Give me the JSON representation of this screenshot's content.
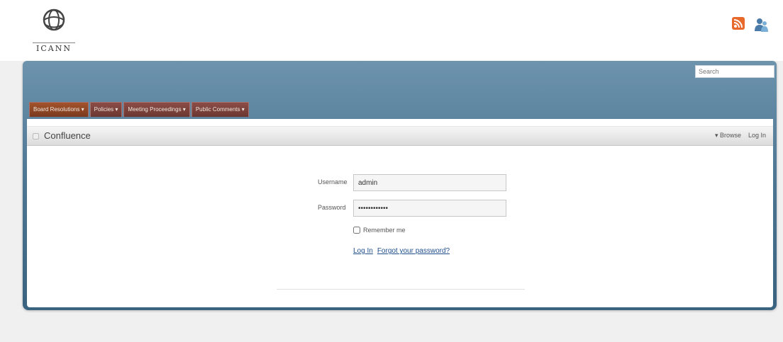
{
  "brand": {
    "logo_text": "ICANN"
  },
  "top_icons": {
    "rss": "rss-icon",
    "user": "user-icon",
    "rss_color": "#e8692c"
  },
  "search": {
    "placeholder": "Search"
  },
  "nav": {
    "tabs": [
      {
        "label": "Board Resolutions ▾"
      },
      {
        "label": "Policies ▾"
      },
      {
        "label": "Meeting Proceedings ▾"
      },
      {
        "label": "Public Comments ▾"
      }
    ]
  },
  "space": {
    "title": "Confluence",
    "browse_label": "▾ Browse",
    "login_label": "Log In"
  },
  "login": {
    "username_label": "Username",
    "username_value": "admin",
    "password_label": "Password",
    "password_value": "••••••••••••",
    "remember_label": "Remember me",
    "login_link": "Log In",
    "forgot_link": "Forgot your password?"
  },
  "colors": {
    "frame_blue": "#4c7592",
    "tab_red": "#7a3a30",
    "link_blue": "#1f4e8c"
  }
}
